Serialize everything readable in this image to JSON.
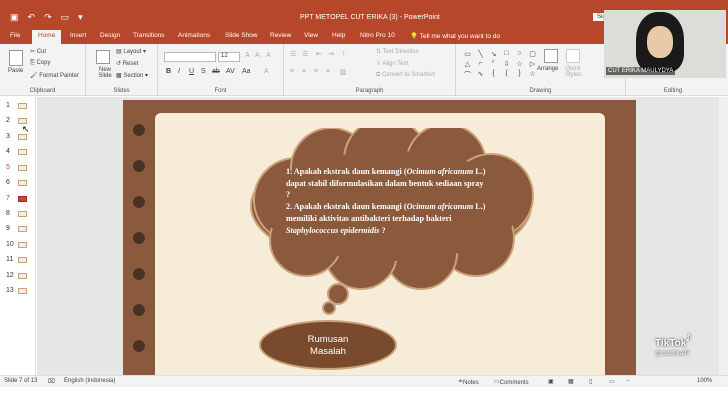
{
  "window": {
    "title": "PPT METOPEL CUT ERIKA (3)  -  PowerPoint",
    "sign_in": "Sign in"
  },
  "quick_access": [
    "save-icon",
    "undo-icon",
    "redo-icon",
    "present-icon",
    "customize-icon"
  ],
  "tabs": [
    "File",
    "Home",
    "Insert",
    "Design",
    "Transitions",
    "Animations",
    "Slide Show",
    "Review",
    "View",
    "Help",
    "Nitro Pro 10"
  ],
  "active_tab": "Home",
  "tell_me": "Tell me what you want to do",
  "ribbon": {
    "clipboard": {
      "label": "Clipboard",
      "paste": "Paste",
      "cut": "Cut",
      "copy": "Copy",
      "format_painter": "Format Painter"
    },
    "slides": {
      "label": "Slides",
      "new_slide": "New Slide",
      "layout": "Layout",
      "reset": "Reset",
      "section": "Section"
    },
    "font": {
      "label": "Font",
      "font_name": "",
      "font_size": "12"
    },
    "paragraph": {
      "label": "Paragraph",
      "text_direction": "Text Direction",
      "align_text": "Align Text",
      "convert_smartart": "Convert to SmartArt"
    },
    "drawing": {
      "label": "Drawing",
      "arrange": "Arrange",
      "quick_styles": "Quick Styles"
    },
    "editing": {
      "label": "Editing"
    }
  },
  "thumbnails": [
    "1",
    "2",
    "3",
    "4",
    "5",
    "6",
    "7",
    "8",
    "9",
    "10",
    "11",
    "12",
    "13"
  ],
  "selected_slide": "7",
  "slide": {
    "q1_line1": "1. Apakah ekstrak daun kemangi (",
    "q1_italic1": "Ocimum africanum",
    "q1_line2": " L.) dapat stabil diformulasikan dalam bentuk sediaan spray ?",
    "q2_line1": "2. Apakah ekstrak daun kemangi (",
    "q2_italic1": "Ocimum africanum",
    "q2_line2": " L.) memiliki aktivitas antibakteri terhadap bakteri ",
    "q2_italic2": "Staphylococcus epidermidis",
    "q2_line3": " ?",
    "badge_line1": "Rumusan",
    "badge_line2": "Masalah"
  },
  "status": {
    "slide_of": "Slide 7 of 13",
    "language": "English (Indonesia)",
    "notes": "Notes",
    "comments": "Comments",
    "zoom": "100%"
  },
  "webcam": {
    "name": "CUT ERIKA MAULYDYA"
  },
  "overlay": {
    "brand": "TikTok",
    "handle": "@cutchika97"
  },
  "colors": {
    "accent": "#b7472a",
    "slide_frame": "#8b5a3c",
    "paper": "#f6ecd8",
    "cloud": "#8b5a3c"
  }
}
